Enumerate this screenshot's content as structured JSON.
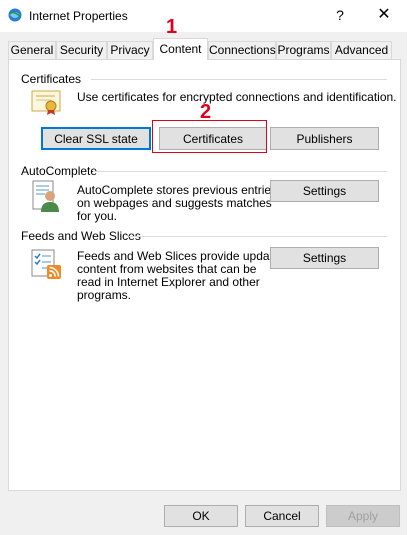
{
  "window": {
    "title": "Internet Properties",
    "help_label": "?",
    "close_label": "✕"
  },
  "tabs": [
    {
      "label": "General"
    },
    {
      "label": "Security"
    },
    {
      "label": "Privacy"
    },
    {
      "label": "Content"
    },
    {
      "label": "Connections"
    },
    {
      "label": "Programs"
    },
    {
      "label": "Advanced"
    }
  ],
  "active_tab": "Content",
  "certificates": {
    "title": "Certificates",
    "description": "Use certificates for encrypted connections and identification.",
    "clear_ssl_label": "Clear SSL state",
    "certificates_label": "Certificates",
    "publishers_label": "Publishers"
  },
  "autocomplete": {
    "title": "AutoComplete",
    "description_lines": [
      "AutoComplete stores previous entries",
      "on webpages and suggests matches",
      "for you."
    ],
    "settings_label": "Settings"
  },
  "feeds": {
    "title": "Feeds and Web Slices",
    "description_lines": [
      "Feeds and Web Slices provide updated",
      "content from websites that can be",
      "read in Internet Explorer and other",
      "programs."
    ],
    "settings_label": "Settings"
  },
  "footer": {
    "ok_label": "OK",
    "cancel_label": "Cancel",
    "apply_label": "Apply"
  },
  "annotations": {
    "step1": "1",
    "step2": "2"
  },
  "colors": {
    "annotation": "#e0001b",
    "focus": "#0078d7"
  }
}
